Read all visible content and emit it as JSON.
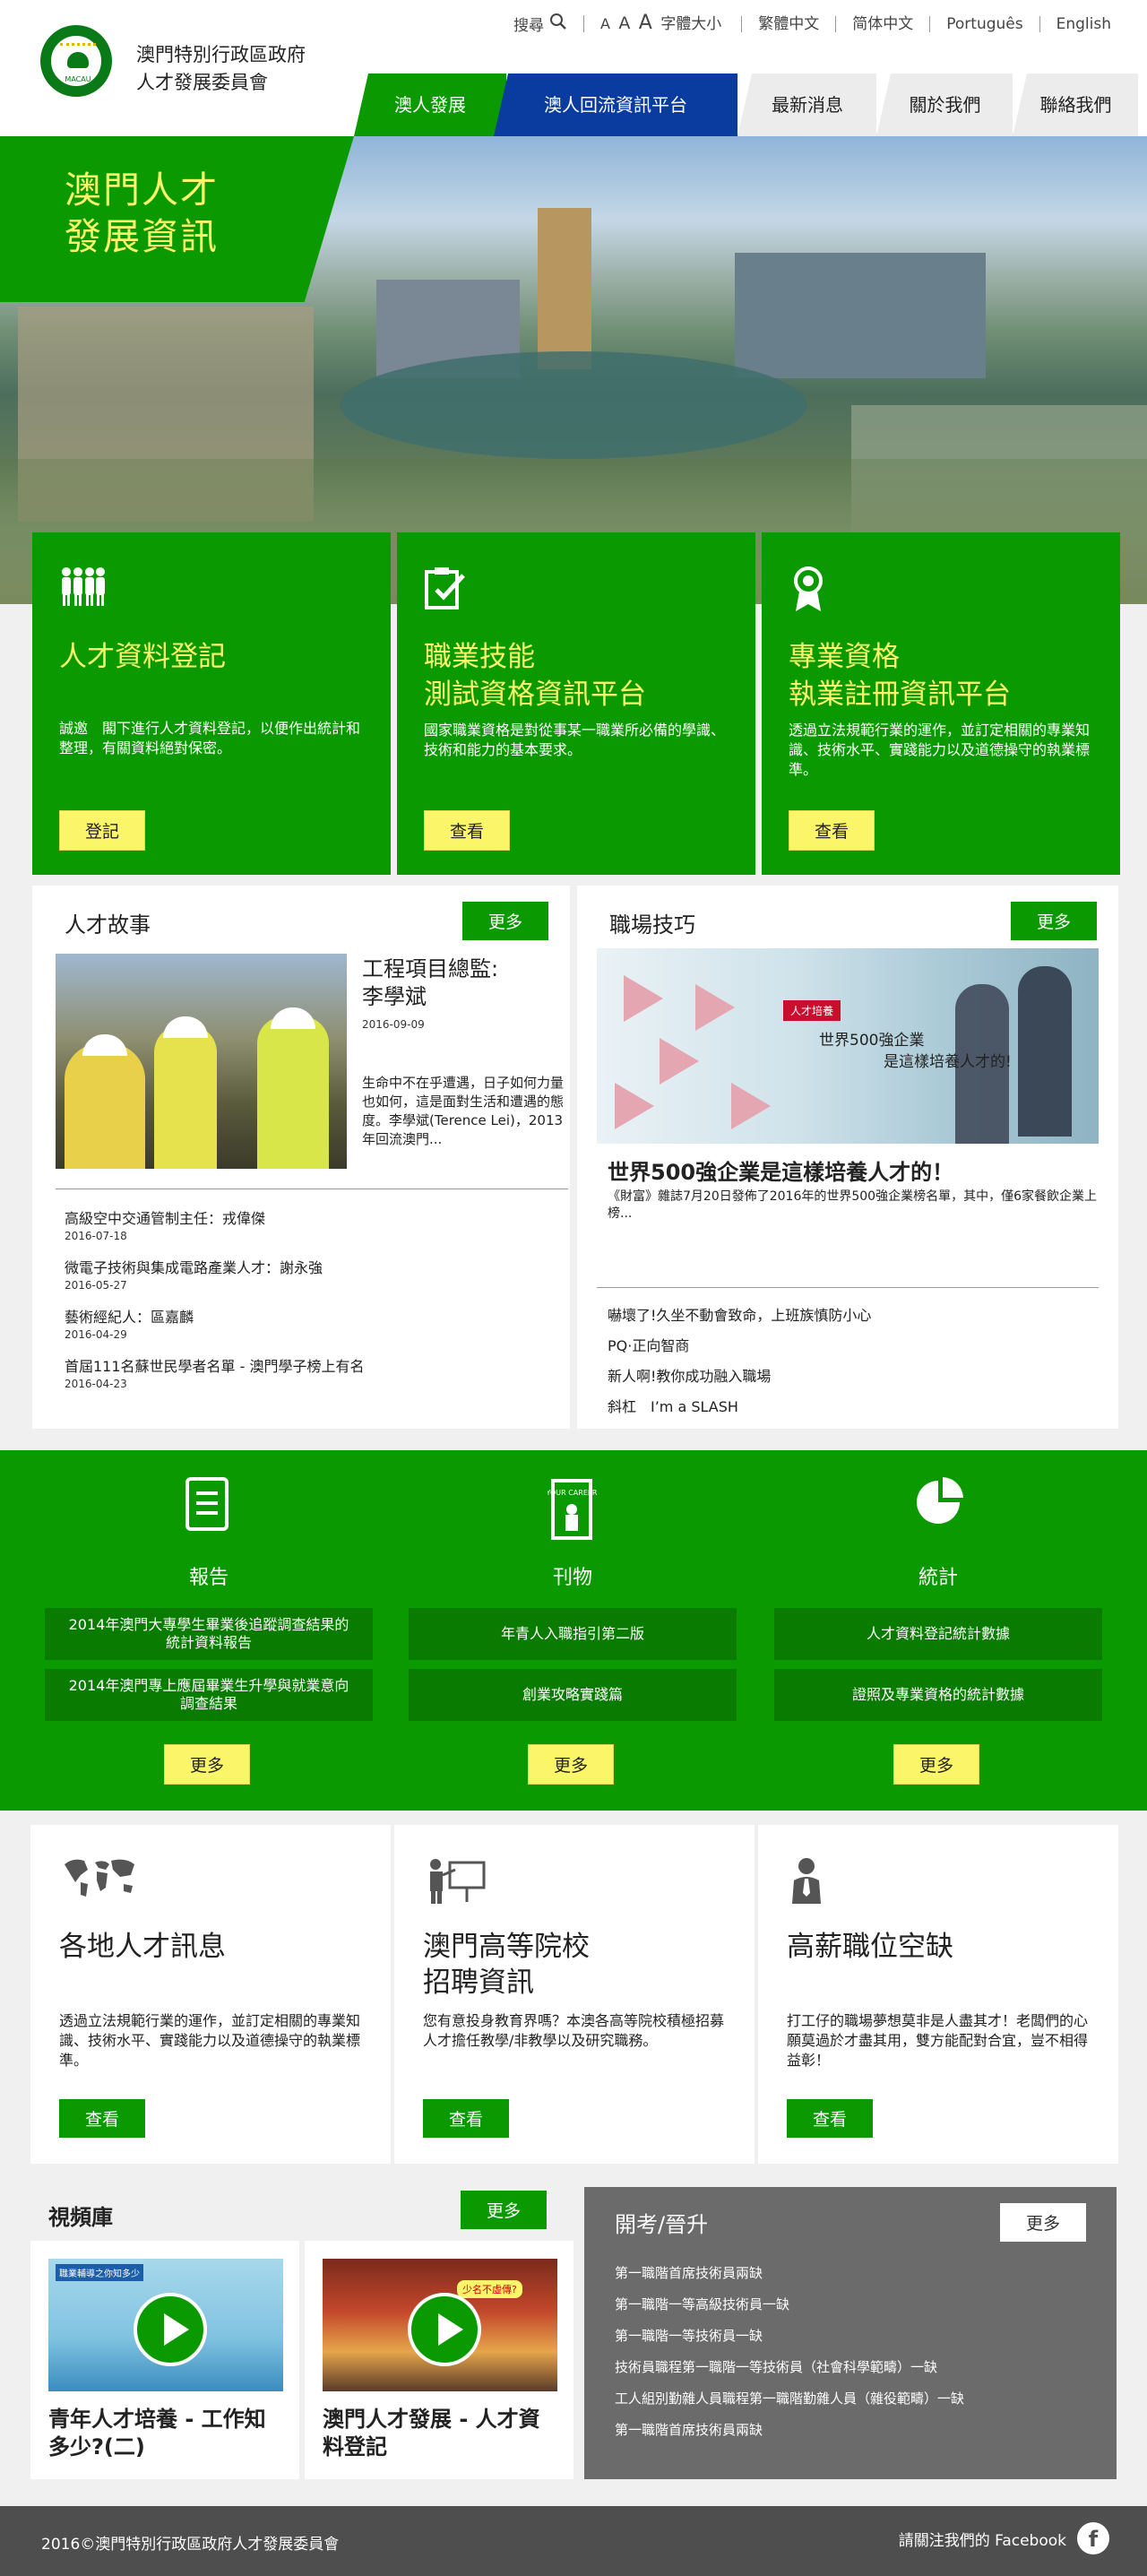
{
  "header": {
    "site_title_line1": "澳門特別行政區政府",
    "site_title_line2": "人才發展委員會",
    "logo_text": "MACAU",
    "util": {
      "search_label": "搜尋",
      "font_sizes": [
        "A",
        "A",
        "A"
      ],
      "font_size_label": "字體大小",
      "languages": [
        "繁體中文",
        "简体中文",
        "Português",
        "English"
      ]
    },
    "nav": [
      "澳人發展",
      "澳人回流資訊平台",
      "最新消息",
      "關於我們",
      "聯絡我們"
    ]
  },
  "hero": {
    "title_line1": "澳門人才",
    "title_line2": "發展資訊"
  },
  "features": [
    {
      "title_line1": "人才資料登記",
      "title_line2": "",
      "desc": "誠邀　閣下進行人才資料登記，以便作出統計和整理，有關資料絕對保密。",
      "button": "登記"
    },
    {
      "title_line1": "職業技能",
      "title_line2": "測試資格資訊平台",
      "desc": "國家職業資格是對從事某一職業所必備的學識、技術和能力的基本要求。",
      "button": "查看"
    },
    {
      "title_line1": "專業資格",
      "title_line2": "執業註冊資訊平台",
      "desc": "透過立法規範行業的運作，並訂定相關的專業知識、技術水平、實踐能力以及道德操守的執業標準。",
      "button": "查看"
    }
  ],
  "story": {
    "heading": "人才故事",
    "more": "更多",
    "headline_line1": "工程項目總監:",
    "headline_line2": "李學斌",
    "date": "2016-09-09",
    "summary": "生命中不在乎遭遇，日子如何力量也如何，這是面對生活和遭遇的態度。李學斌(Terence Lei)，2013年回流澳門...",
    "items": [
      {
        "title": "高級空中交通管制主任：戎偉傑",
        "date": "2016-07-18"
      },
      {
        "title": "微電子技術與集成電路產業人才：謝永強",
        "date": "2016-05-27"
      },
      {
        "title": "藝術經紀人：區嘉麟",
        "date": "2016-04-29"
      },
      {
        "title": "首屆111名蘇世民學者名單 - 澳門學子榜上有名",
        "date": "2016-04-23"
      }
    ]
  },
  "tips": {
    "heading": "職場技巧",
    "more": "更多",
    "photo_tag": "人才培養",
    "photo_text_line1": "世界500強企業",
    "photo_text_line2": "是這樣培養人才的!",
    "headline": "世界500強企業是這樣培養人才的！",
    "summary": "《財富》雜誌7月20日發佈了2016年的世界500強企業榜名單，其中，僅6家餐飲企業上榜...",
    "items": [
      "嚇壞了!久坐不動會致命，上班族慎防小心",
      "PQ·正向智商",
      "新人啊!教你成功融入職場",
      "斜杠　I’m a SLASH"
    ]
  },
  "pubs": {
    "columns": [
      {
        "title": "報告",
        "items": [
          "2014年澳門大專學生畢業後追蹤調查結果的統計資料報告",
          "2014年澳門專上應屆畢業生升學與就業意向調查結果"
        ],
        "more": "更多",
        "icon": "report-icon"
      },
      {
        "title": "刊物",
        "items": [
          "年青人入職指引第二版",
          "創業攻略實踐篇"
        ],
        "more": "更多",
        "icon": "book-icon",
        "book_text": "YOUR CAREER"
      },
      {
        "title": "統計",
        "items": [
          "人才資料登記統計數據",
          "證照及專業資格的統計數據"
        ],
        "more": "更多",
        "icon": "pie-chart-icon"
      }
    ]
  },
  "info": [
    {
      "title_line1": "各地人才訊息",
      "title_line2": "",
      "desc": "透過立法規範行業的運作，並訂定相關的專業知識、技術水平、實踐能力以及道德操守的執業標準。",
      "button": "查看",
      "icon": "world-map-icon"
    },
    {
      "title_line1": "澳門高等院校",
      "title_line2": "招聘資訊",
      "desc": "您有意投身教育界嗎？本澳各高等院校積極招募人才擔任教學/非教學以及研究職務。",
      "button": "查看",
      "icon": "teacher-board-icon"
    },
    {
      "title_line1": "高薪職位空缺",
      "title_line2": "",
      "desc": "打工仔的職場夢想莫非是人盡其才！老闆們的心願莫過於才盡其用，雙方能配對合宜，豈不相得益彰！",
      "button": "查看",
      "icon": "businessman-icon"
    }
  ],
  "video": {
    "heading": "視頻庫",
    "more": "更多",
    "items": [
      {
        "title": "青年人才培養 - 工作知多少?(二)",
        "thumb_caption": "職業輔導之你知多少"
      },
      {
        "title": "澳門人才發展 - 人才資料登記",
        "thumb_caption": "少名不虛傳?"
      }
    ]
  },
  "exam": {
    "heading": "開考/晉升",
    "more": "更多",
    "items": [
      "第一職階首席技術員兩缺",
      "第一職階一等高級技術員一缺",
      "第一職階一等技術員一缺",
      "技術員職程第一職階一等技術員（社會科學範疇）一缺",
      "工人組別勤雜人員職程第一職階勤雜人員（雜役範疇）一缺",
      "第一職階首席技術員兩缺"
    ]
  },
  "footer": {
    "copyright": "2016©澳門特別行政區政府人才發展委員會",
    "facebook_label": "請關注我們的 Facebook",
    "facebook_icon": "f"
  },
  "colors": {
    "brand_green": "#0a9a00",
    "nav_blue": "#0a3ca0",
    "accent_yellow": "#fbf56a",
    "footer_gray": "#4e4e4e",
    "exam_gray": "#6b6b6b"
  }
}
